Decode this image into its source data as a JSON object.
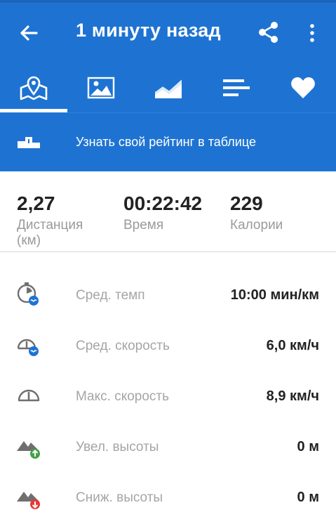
{
  "header": {
    "title": "1 минуту назад",
    "back_icon": "arrow-back-icon",
    "share_icon": "share-icon",
    "more_icon": "more-vertical-icon",
    "background": "#1e73d2"
  },
  "tabs": [
    {
      "icon": "map-icon",
      "selected": true
    },
    {
      "icon": "photo-icon",
      "selected": false
    },
    {
      "icon": "chart-icon",
      "selected": false
    },
    {
      "icon": "splits-icon",
      "selected": false
    },
    {
      "icon": "heart-icon",
      "selected": false
    }
  ],
  "leaderboard": {
    "text": "Узнать свой рейтинг в таблице",
    "icon": "podium-icon"
  },
  "summary": {
    "distance": {
      "value": "2,27",
      "label": "Дистанция",
      "unit": "(км)"
    },
    "time": {
      "value": "00:22:42",
      "label": "Время"
    },
    "calories": {
      "value": "229",
      "label": "Калории"
    }
  },
  "details": [
    {
      "label": "Сред. темп",
      "value": "10:00 мин/км",
      "icon": "avg-pace-icon"
    },
    {
      "label": "Сред. скорость",
      "value": "6,0 км/ч",
      "icon": "avg-speed-icon"
    },
    {
      "label": "Макс. скорость",
      "value": "8,9 км/ч",
      "icon": "max-speed-icon"
    },
    {
      "label": "Увел. высоты",
      "value": "0 м",
      "icon": "elevation-gain-icon"
    },
    {
      "label": "Сниж. высоты",
      "value": "0 м",
      "icon": "elevation-loss-icon"
    }
  ]
}
